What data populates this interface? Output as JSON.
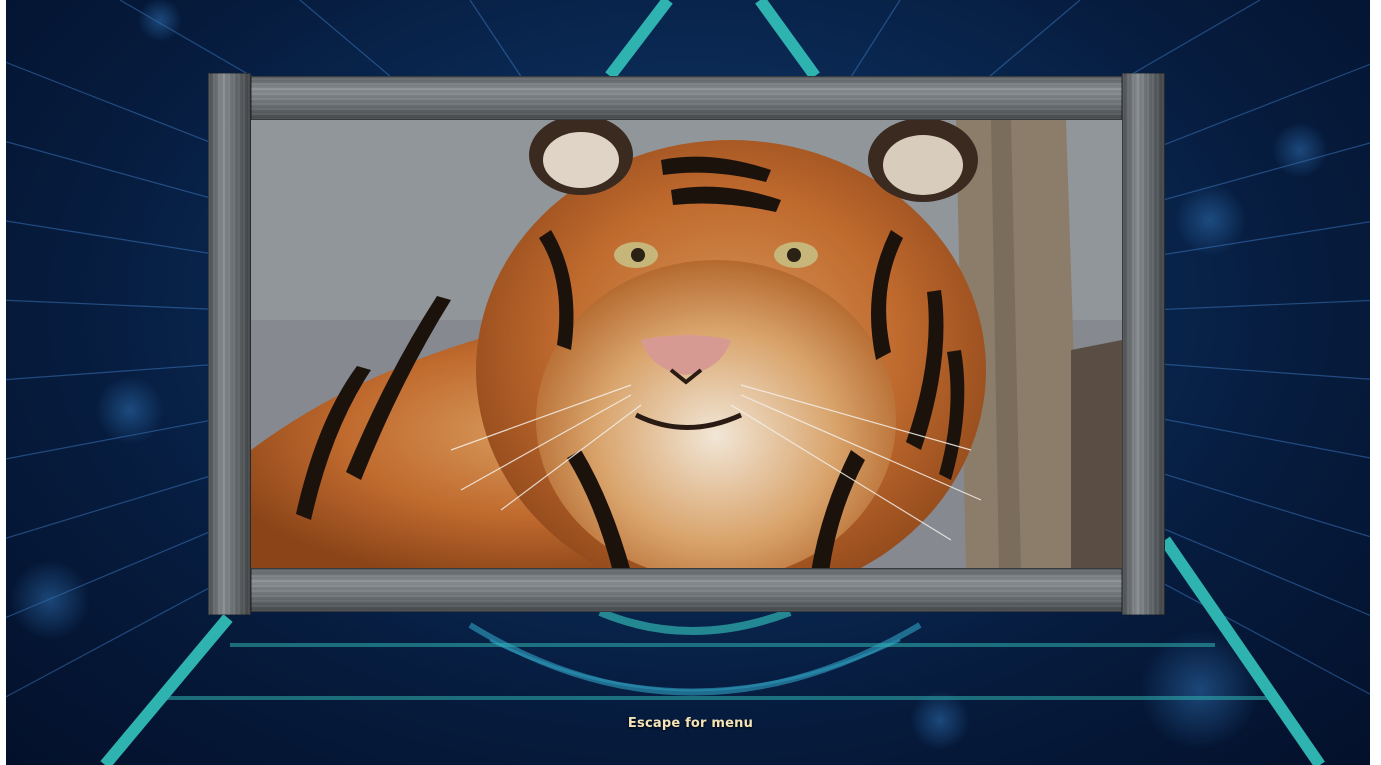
{
  "hint": {
    "escape_text": "Escape for menu"
  },
  "colors": {
    "background": "#041634",
    "accent_teal": "#2fb3b0",
    "frame_metal": "#7a7f83",
    "hint_text": "#f3e3b8"
  },
  "scene": {
    "picture_subject_icon": "tiger-photo-icon",
    "frame_icon": "picture-frame-icon"
  }
}
